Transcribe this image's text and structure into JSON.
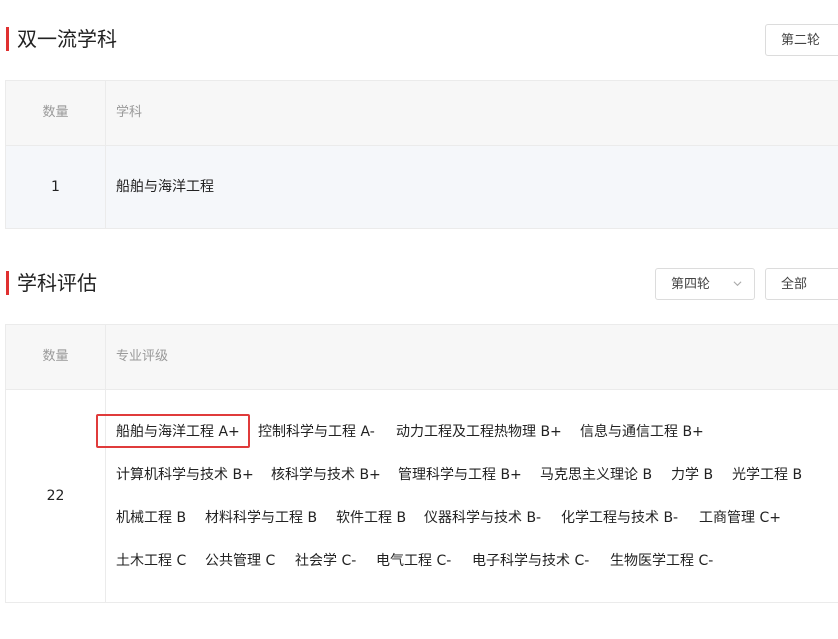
{
  "double_first_class": {
    "title": "双一流学科",
    "round_select": "第二轮",
    "table": {
      "headers": {
        "count": "数量",
        "subject": "学科"
      },
      "row": {
        "count": "1",
        "subject": "船舶与海洋工程"
      }
    }
  },
  "evaluation": {
    "title": "学科评估",
    "round_select": "第四轮",
    "filter_select": "全部",
    "table": {
      "headers": {
        "count": "数量",
        "grade": "专业评级"
      },
      "row": {
        "count": "22",
        "tags": [
          "船舶与海洋工程 A+",
          "控制科学与工程 A-",
          "动力工程及工程热物理 B+",
          "信息与通信工程 B+",
          "计算机科学与技术 B+",
          "核科学与技术 B+",
          "管理科学与工程 B+",
          "马克思主义理论 B",
          "力学 B",
          "光学工程 B",
          "机械工程 B",
          "材料科学与工程 B",
          "软件工程 B",
          "仪器科学与技术 B-",
          "化学工程与技术 B-",
          "工商管理 C+",
          "土木工程 C",
          "公共管理 C",
          "社会学 C-",
          "电气工程 C-",
          "电子科学与技术 C-",
          "生物医学工程 C-"
        ]
      }
    }
  },
  "colors": {
    "accent": "#e03030",
    "highlight_border": "#e03b3b"
  },
  "icons": {
    "dropdown": "chevron-down-icon"
  }
}
